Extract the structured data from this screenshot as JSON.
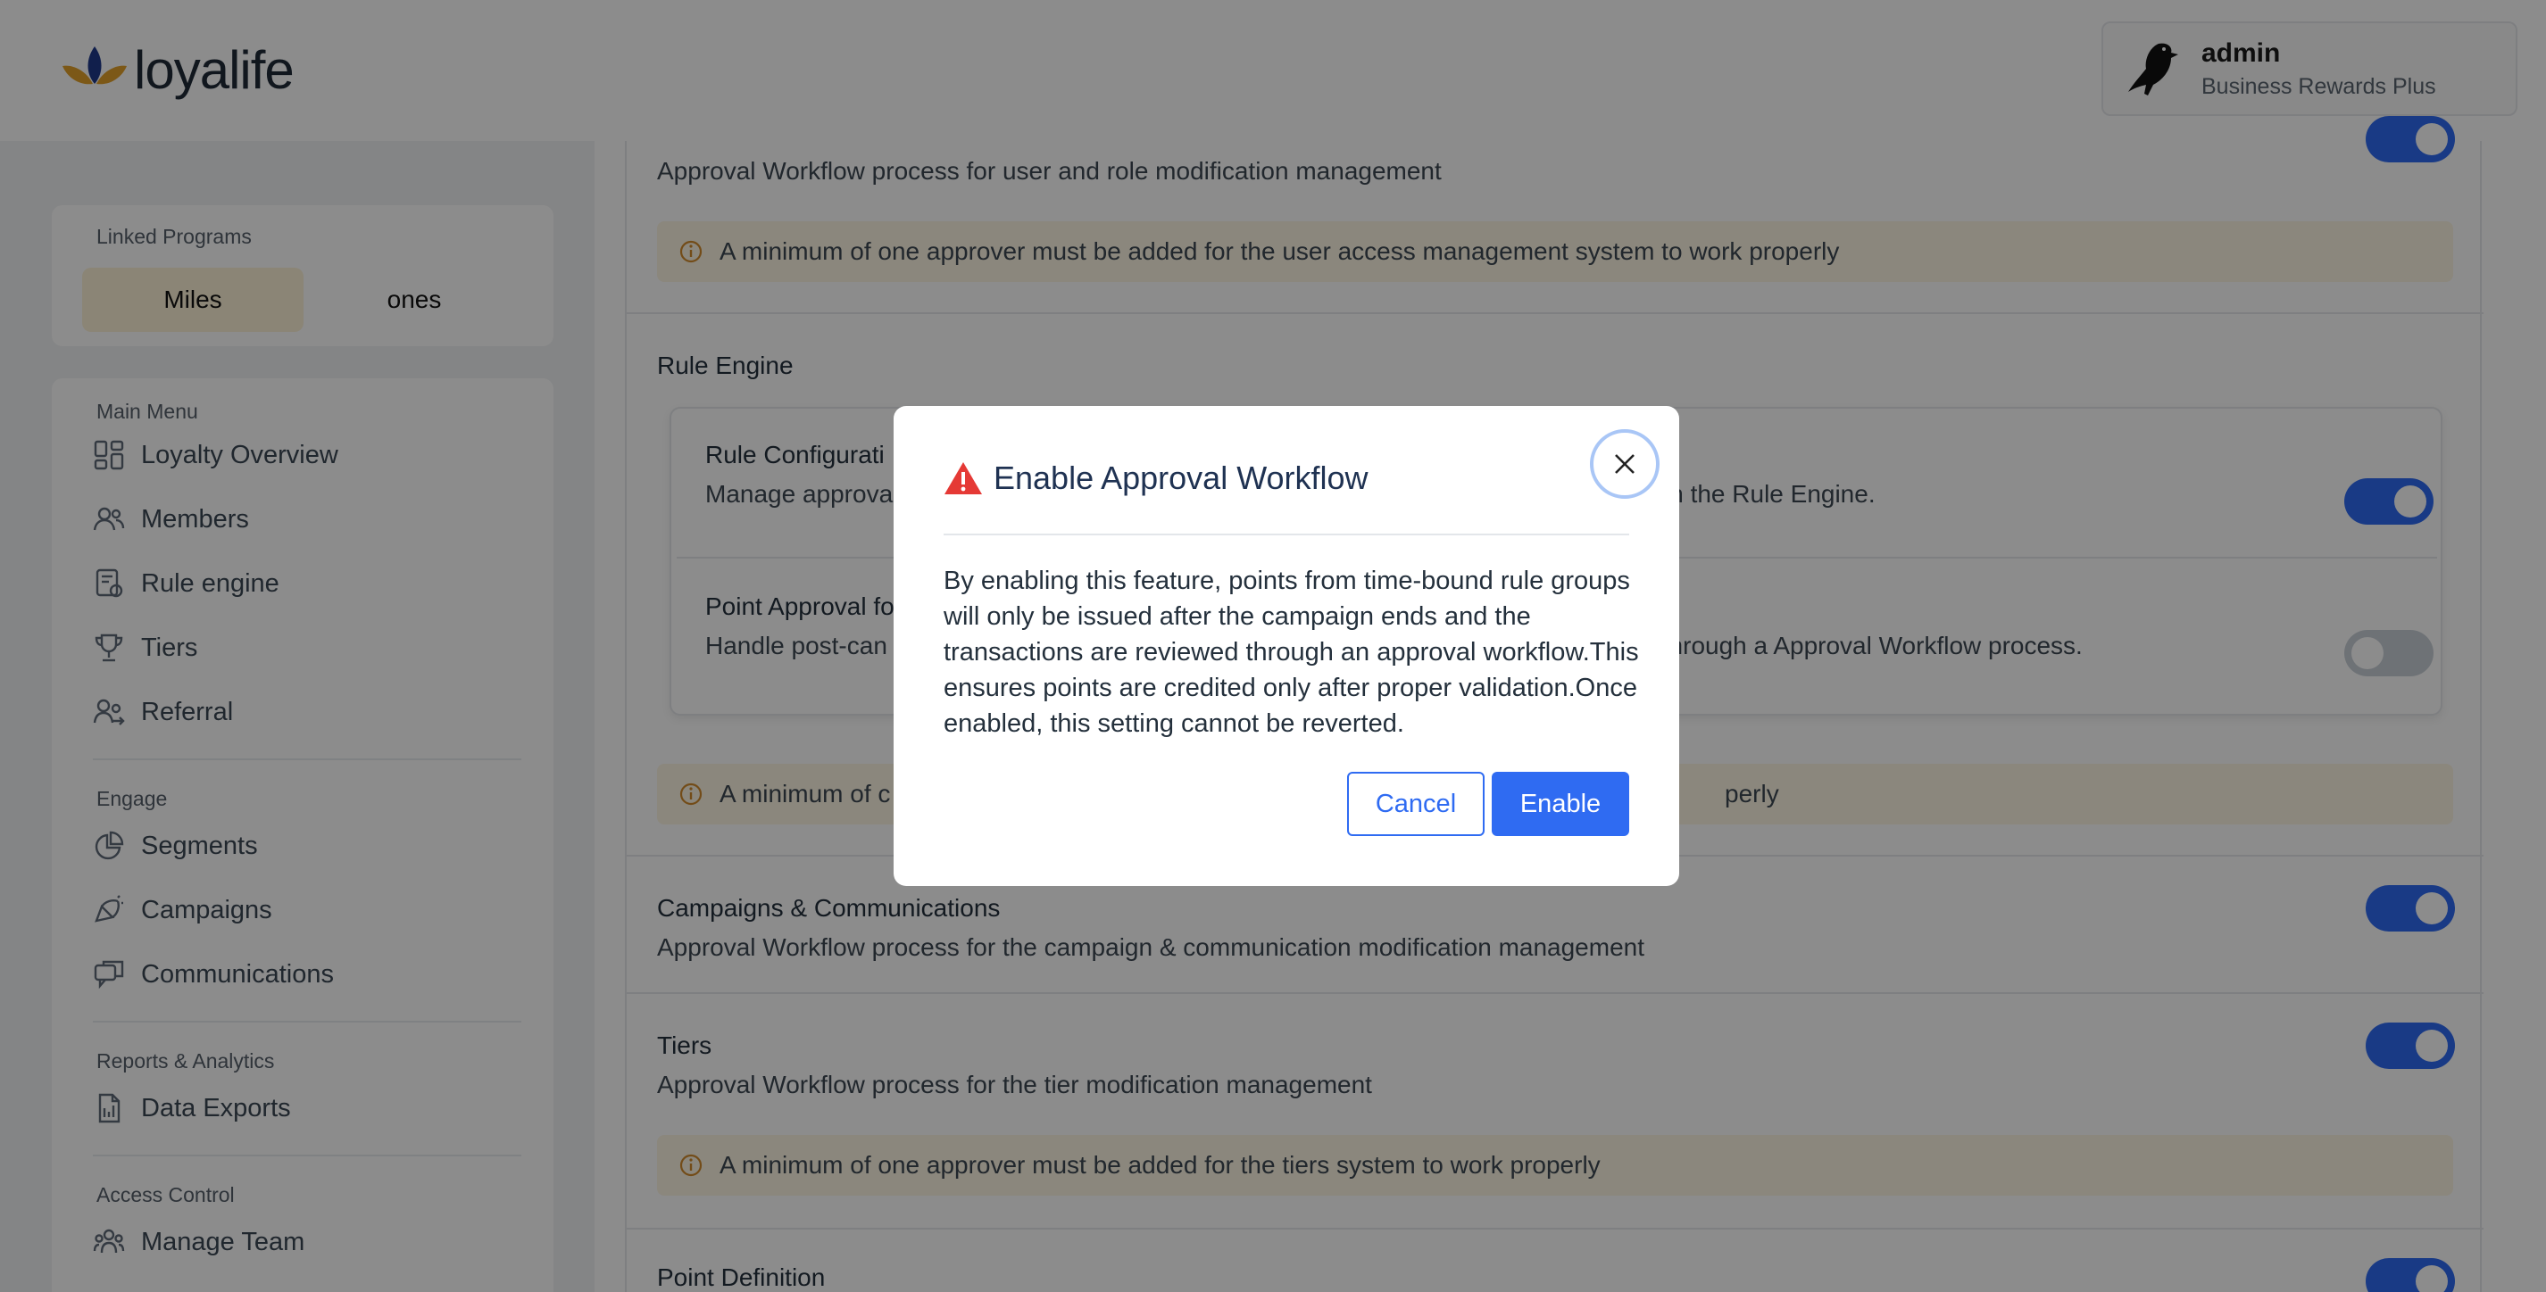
{
  "header": {
    "logo_text": "loyalife",
    "user_name": "admin",
    "user_org": "Business Rewards Plus"
  },
  "sidebar": {
    "linked_programs_label": "Linked Programs",
    "programs": [
      "Miles",
      "ones"
    ],
    "main_menu_label": "Main Menu",
    "main_menu": [
      {
        "label": "Loyalty Overview",
        "icon": "dashboard-icon"
      },
      {
        "label": "Members",
        "icon": "members-icon"
      },
      {
        "label": "Rule engine",
        "icon": "rule-engine-icon"
      },
      {
        "label": "Tiers",
        "icon": "trophy-icon"
      },
      {
        "label": "Referral",
        "icon": "referral-icon"
      }
    ],
    "engage_label": "Engage",
    "engage": [
      {
        "label": "Segments",
        "icon": "pie-chart-icon"
      },
      {
        "label": "Campaigns",
        "icon": "megaphone-icon"
      },
      {
        "label": "Communications",
        "icon": "chat-icon"
      }
    ],
    "reports_label": "Reports & Analytics",
    "reports": [
      {
        "label": "Data Exports",
        "icon": "file-export-icon"
      }
    ],
    "access_label": "Access Control",
    "access": [
      {
        "label": "Manage Team",
        "icon": "team-icon"
      }
    ]
  },
  "main": {
    "user_access_desc": "Approval Workflow process for user and role modification management",
    "user_access_warning": "A minimum of one approver must be added for the user access management system to work properly",
    "rule_engine_title": "Rule Engine",
    "rule_config_title": "Rule Configurati",
    "rule_config_desc_left": "Manage approva",
    "rule_config_desc_right": "in the Rule Engine.",
    "point_approval_title": "Point Approval fo",
    "point_approval_desc_left": "Handle post-can",
    "point_approval_desc_right": "s through a Approval Workflow process.",
    "rule_engine_warning_left": "A minimum of c",
    "rule_engine_warning_right": "perly",
    "campaigns_title": "Campaigns & Communications",
    "campaigns_desc": "Approval Workflow process for the campaign & communication modification management",
    "tiers_title": "Tiers",
    "tiers_desc": "Approval Workflow process for the tier modification management",
    "tiers_warning": "A minimum of one approver must be added for the tiers system to work properly",
    "point_definition_title": "Point Definition"
  },
  "modal": {
    "title": "Enable Approval Workflow",
    "body": "By enabling this feature, points from time-bound rule groups will only be issued after the campaign ends and the transactions are reviewed through an approval workflow.This ensures points are credited only after proper validation.Once enabled, this setting cannot be reverted.",
    "cancel_label": "Cancel",
    "enable_label": "Enable"
  },
  "colors": {
    "primary": "#2f6bf2",
    "warning_bg": "#fdf6e3",
    "warning_icon": "#d18a2c",
    "danger": "#e53935"
  }
}
